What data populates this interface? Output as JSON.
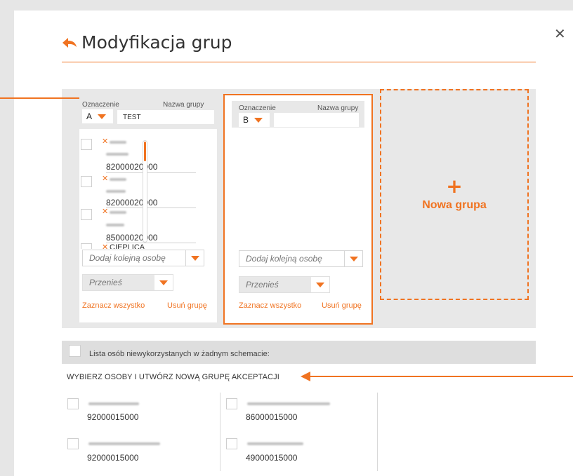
{
  "header": {
    "title": "Modyfikacja grup",
    "close_label": "✕"
  },
  "groups": [
    {
      "designation_label": "Oznaczenie",
      "name_label": "Nazwa grupy",
      "designation_value": "A",
      "name_value": "TEST",
      "members": [
        {
          "account": "82000020000"
        },
        {
          "account": "82000020000"
        },
        {
          "account": "85000020000"
        },
        {
          "name_partial": "CIEPLICA"
        }
      ],
      "add_person_placeholder": "Dodaj kolejną osobę",
      "move_placeholder": "Przenieś",
      "select_all": "Zaznacz wszystko",
      "delete_group": "Usuń grupę"
    },
    {
      "designation_label": "Oznaczenie",
      "name_label": "Nazwa grupy",
      "designation_value": "B",
      "name_value": "",
      "members": [],
      "add_person_placeholder": "Dodaj kolejną osobę",
      "move_placeholder": "Przenieś",
      "select_all": "Zaznacz wszystko",
      "delete_group": "Usuń grupę"
    }
  ],
  "new_group": {
    "plus": "+",
    "label": "Nowa grupa"
  },
  "unused": {
    "label": "Lista osób niewykorzystanych w żadnym schemacie:",
    "instruction": "WYBIERZ OSOBY I UTWÓRZ NOWĄ GRUPĘ AKCEPTACJI",
    "people": [
      {
        "account": "92000015000"
      },
      {
        "account": "86000015000"
      },
      {
        "account": "92000015000"
      },
      {
        "account": "49000015000"
      }
    ]
  },
  "colors": {
    "accent": "#f07321",
    "panel_bg": "#e8e8e8",
    "page_bg": "#e6e6e6"
  }
}
